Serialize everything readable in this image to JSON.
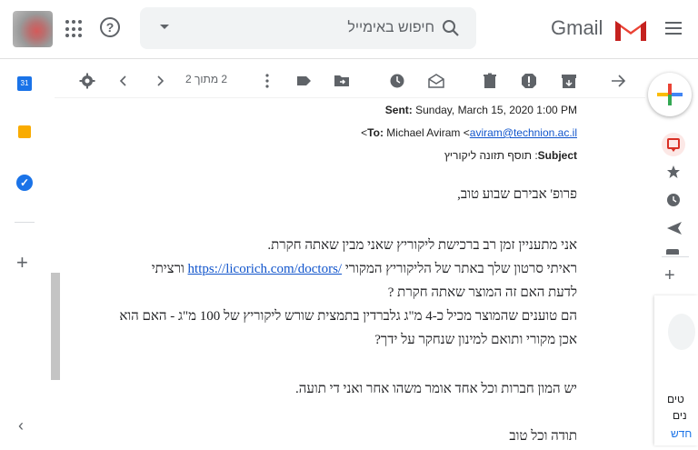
{
  "search": {
    "placeholder": "חיפוש באימייל"
  },
  "brand": {
    "name": "Gmail"
  },
  "toolbar": {
    "pager": "2 מתוך 2"
  },
  "rail": {
    "calendar_label": "31"
  },
  "email": {
    "sent_label": "Sent:",
    "sent_value": "Sunday, March 15, 2020 1:00 PM",
    "to_prefix": "<",
    "to_label": "To:",
    "to_name": "Michael Aviram <",
    "to_email": "aviram@technion.ac.il",
    "subject_label": "Subject",
    "subject_value": ": תוסף תזונה ליקוריץ",
    "body": {
      "greeting": "פרופ' אבירם שבוע טוב,",
      "line1": "אני מתעניין זמן רב ברכישת ליקוריץ שאני מבין שאתה חקרת.",
      "line2_start": "ראיתי סרטון שלך באתר של הליקוריץ המקורי ",
      "line2_link": "https://licorich.com/doctors/",
      "line2_end": " ורציתי",
      "line3": "לדעת האם זה המוצר שאתה חקרת ?",
      "line4": "הם טוענים שהמוצר מכיל כ-4 מ\"ג גלברדין בתמצית שורש ליקוריץ של 100 מ\"ג - האם הוא",
      "line5": "אכן מקורי ותואם למינון שנחקר על ידך?",
      "line6": "יש המון חברות וכל אחד אומר משהו אחר ואני די תועה.",
      "line7": "תודה וכל טוב"
    }
  },
  "side_card": {
    "line1": "טים",
    "line2": "נים",
    "link": "חדש"
  },
  "colors": {
    "link": "#1155cc",
    "gmail_red": "#ea4335",
    "compose_plus": [
      "#ea4335",
      "#fbbc04",
      "#34a853",
      "#4285f4"
    ]
  }
}
